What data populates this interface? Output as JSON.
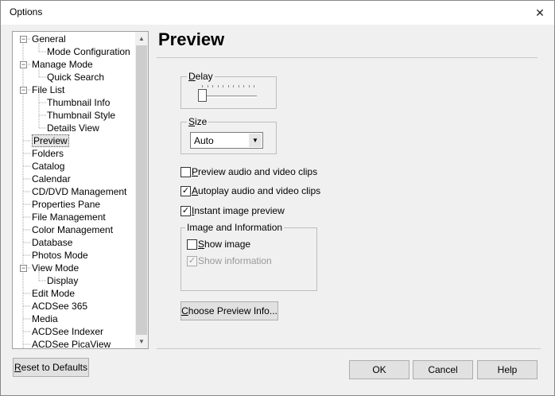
{
  "window": {
    "title": "Options",
    "close_glyph": "✕"
  },
  "tree": {
    "items": [
      {
        "label": "General",
        "level": 0,
        "expander": "−"
      },
      {
        "label": "Mode Configuration",
        "level": 1
      },
      {
        "label": "Manage Mode",
        "level": 0,
        "expander": "−"
      },
      {
        "label": "Quick Search",
        "level": 1
      },
      {
        "label": "File List",
        "level": 0,
        "expander": "−"
      },
      {
        "label": "Thumbnail Info",
        "level": 1
      },
      {
        "label": "Thumbnail Style",
        "level": 1
      },
      {
        "label": "Details View",
        "level": 1
      },
      {
        "label": "Preview",
        "level": 0,
        "selected": true
      },
      {
        "label": "Folders",
        "level": 0
      },
      {
        "label": "Catalog",
        "level": 0
      },
      {
        "label": "Calendar",
        "level": 0
      },
      {
        "label": "CD/DVD Management",
        "level": 0
      },
      {
        "label": "Properties Pane",
        "level": 0
      },
      {
        "label": "File Management",
        "level": 0
      },
      {
        "label": "Color Management",
        "level": 0
      },
      {
        "label": "Database",
        "level": 0
      },
      {
        "label": "Photos Mode",
        "level": 0
      },
      {
        "label": "View Mode",
        "level": 0,
        "expander": "−"
      },
      {
        "label": "Display",
        "level": 1
      },
      {
        "label": "Edit Mode",
        "level": 0
      },
      {
        "label": "ACDSee 365",
        "level": 0
      },
      {
        "label": "Media",
        "level": 0
      },
      {
        "label": "ACDSee Indexer",
        "level": 0
      },
      {
        "label": "ACDSee PicaView",
        "level": 0
      }
    ],
    "scroll_up_glyph": "▲",
    "scroll_down_glyph": "▼"
  },
  "page": {
    "title": "Preview"
  },
  "delay": {
    "label_key": "D",
    "label_rest": "elay",
    "slider_level": 0
  },
  "size": {
    "label_key": "S",
    "label_rest": "ize",
    "value": "Auto",
    "arrow_glyph": "▼"
  },
  "options": {
    "preview_clips": {
      "key": "P",
      "rest": "review audio and video clips",
      "checked": false,
      "check_glyph": ""
    },
    "autoplay_clips": {
      "key": "A",
      "rest": "utoplay audio and video clips",
      "checked": true,
      "check_glyph": "✓"
    },
    "instant_preview": {
      "key": "I",
      "rest": "nstant image preview",
      "checked": true,
      "check_glyph": "✓"
    }
  },
  "image_info": {
    "group_label": "Image and Information",
    "show_image": {
      "key": "S",
      "rest": "how image",
      "checked": false,
      "check_glyph": ""
    },
    "show_information": {
      "label": "Show information",
      "checked": true,
      "disabled": true,
      "check_glyph": "✓"
    }
  },
  "buttons": {
    "choose_preview_info_key": "C",
    "choose_preview_info_rest": "hoose Preview Info...",
    "reset_key": "R",
    "reset_rest": "eset to Defaults",
    "ok": "OK",
    "cancel": "Cancel",
    "help": "Help"
  }
}
